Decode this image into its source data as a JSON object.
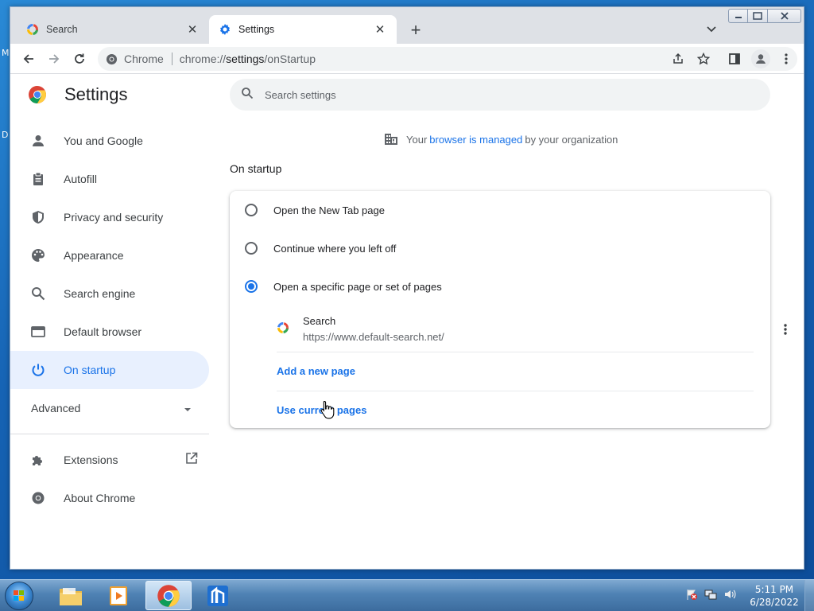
{
  "desktop": {
    "fragments": [
      "M",
      "D"
    ]
  },
  "window": {
    "controls": {
      "minimize": "minimize",
      "maximize": "maximize",
      "close": "close"
    }
  },
  "tabs": [
    {
      "title": "Search",
      "active": false
    },
    {
      "title": "Settings",
      "active": true
    }
  ],
  "toolbar": {
    "omnibox_chip": "Chrome",
    "url_prefix": "chrome://",
    "url_host": "settings",
    "url_path": "/onStartup"
  },
  "settings": {
    "title": "Settings",
    "search_placeholder": "Search settings",
    "nav": [
      {
        "label": "You and Google",
        "icon": "person-icon"
      },
      {
        "label": "Autofill",
        "icon": "clipboard-icon"
      },
      {
        "label": "Privacy and security",
        "icon": "shield-icon"
      },
      {
        "label": "Appearance",
        "icon": "palette-icon"
      },
      {
        "label": "Search engine",
        "icon": "search-icon"
      },
      {
        "label": "Default browser",
        "icon": "browser-icon"
      },
      {
        "label": "On startup",
        "icon": "power-icon",
        "selected": true
      }
    ],
    "advanced_label": "Advanced",
    "extensions_label": "Extensions",
    "about_label": "About Chrome",
    "managed": {
      "prefix": "Your",
      "link": "browser is managed",
      "suffix": "by your organization"
    },
    "section_title": "On startup",
    "options": [
      {
        "label": "Open the New Tab page",
        "checked": false
      },
      {
        "label": "Continue where you left off",
        "checked": false
      },
      {
        "label": "Open a specific page or set of pages",
        "checked": true
      }
    ],
    "startup_pages": [
      {
        "name": "Search",
        "url": "https://www.default-search.net/"
      }
    ],
    "add_page_label": "Add a new page",
    "use_current_label": "Use current pages"
  },
  "taskbar": {
    "apps": [
      "file-explorer",
      "media-player",
      "chrome",
      "app"
    ],
    "time": "5:11 PM",
    "date": "6/28/2022"
  },
  "colors": {
    "accent": "#1a73e8",
    "selected_bg": "#e8f0fe"
  }
}
